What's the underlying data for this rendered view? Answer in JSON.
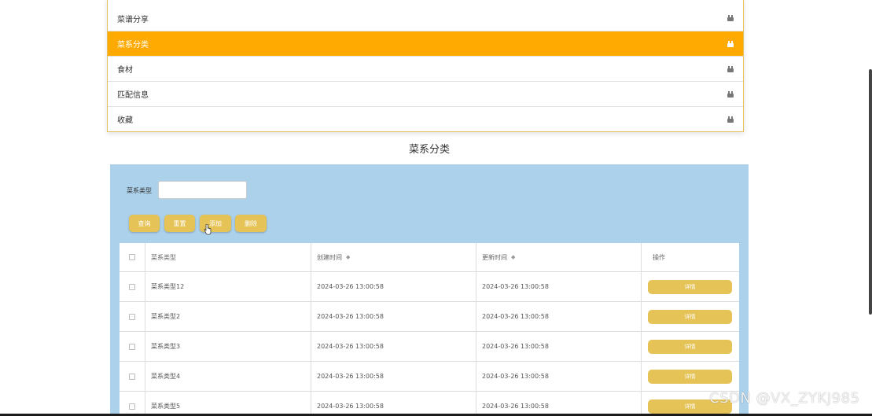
{
  "menu": {
    "items": [
      {
        "label": "菜谱分享",
        "icon": "bag-icon",
        "active": false
      },
      {
        "label": "菜系分类",
        "icon": "bag-icon",
        "active": true
      },
      {
        "label": "食材",
        "icon": "bag-icon",
        "active": false
      },
      {
        "label": "匹配信息",
        "icon": "bag-icon",
        "active": false
      },
      {
        "label": "收藏",
        "icon": "bag-icon",
        "active": false
      }
    ]
  },
  "page_title": "菜系分类",
  "search": {
    "label": "菜系类型",
    "value": ""
  },
  "buttons": {
    "query": "查询",
    "reset": "重置",
    "add": "添加",
    "delete": "删除"
  },
  "table": {
    "headers": {
      "type": "菜系类型",
      "created": "创建时间",
      "updated": "更新时间",
      "actions": "操作"
    },
    "rows": [
      {
        "type": "菜系类型12",
        "created": "2024-03-26 13:00:58",
        "updated": "2024-03-26 13:00:58",
        "action": "详情"
      },
      {
        "type": "菜系类型2",
        "created": "2024-03-26 13:00:58",
        "updated": "2024-03-26 13:00:58",
        "action": "详情"
      },
      {
        "type": "菜系类型3",
        "created": "2024-03-26 13:00:58",
        "updated": "2024-03-26 13:00:58",
        "action": "详情"
      },
      {
        "type": "菜系类型4",
        "created": "2024-03-26 13:00:58",
        "updated": "2024-03-26 13:00:58",
        "action": "详情"
      },
      {
        "type": "菜系类型5",
        "created": "2024-03-26 13:00:58",
        "updated": "2024-03-26 13:00:58",
        "action": "详情"
      }
    ]
  },
  "watermark": "CSDN @VX_ZYKJ985",
  "colors": {
    "accent": "#ffaa00",
    "button": "#e5c357",
    "panel": "#acd1ea"
  }
}
